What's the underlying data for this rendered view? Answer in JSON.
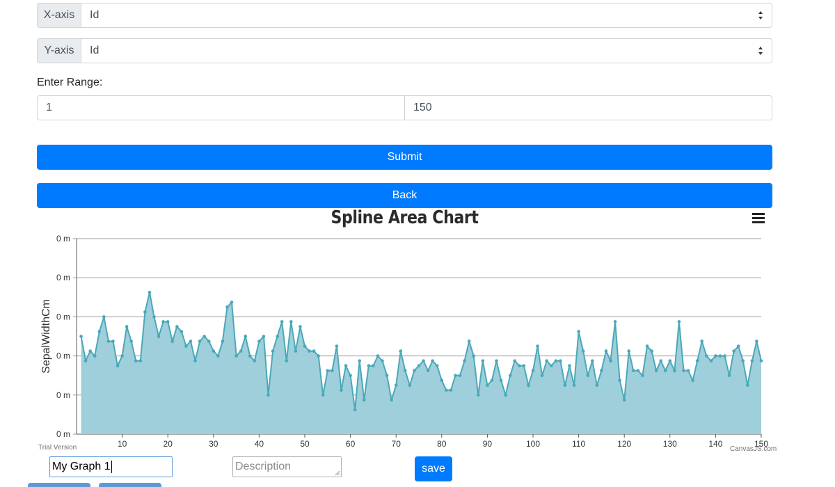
{
  "form": {
    "x_axis": {
      "label": "X-axis",
      "value": "Id"
    },
    "y_axis": {
      "label": "Y-axis",
      "value": "Id"
    },
    "range_label": "Enter Range:",
    "range_from": "1",
    "range_to": "150",
    "submit_label": "Submit",
    "back_label": "Back"
  },
  "chart_data": {
    "type": "area",
    "title": "Spline Area Chart",
    "xlabel": "",
    "ylabel": "SepalWidthCm",
    "xlim": [
      0,
      150
    ],
    "xticks": [
      10,
      20,
      30,
      40,
      50,
      60,
      70,
      80,
      90,
      100,
      110,
      120,
      130,
      140,
      150
    ],
    "ytick_labels": [
      "0 m",
      "0 m",
      "0 m",
      "0 m",
      "0 m",
      "0 m"
    ],
    "ylim": [
      1.5,
      5.5
    ],
    "grid": true,
    "color": "#4aa8b8",
    "fill": "#9ecfda",
    "x": [
      1,
      2,
      3,
      4,
      5,
      6,
      7,
      8,
      9,
      10,
      11,
      12,
      13,
      14,
      15,
      16,
      17,
      18,
      19,
      20,
      21,
      22,
      23,
      24,
      25,
      26,
      27,
      28,
      29,
      30,
      31,
      32,
      33,
      34,
      35,
      36,
      37,
      38,
      39,
      40,
      41,
      42,
      43,
      44,
      45,
      46,
      47,
      48,
      49,
      50,
      51,
      52,
      53,
      54,
      55,
      56,
      57,
      58,
      59,
      60,
      61,
      62,
      63,
      64,
      65,
      66,
      67,
      68,
      69,
      70,
      71,
      72,
      73,
      74,
      75,
      76,
      77,
      78,
      79,
      80,
      81,
      82,
      83,
      84,
      85,
      86,
      87,
      88,
      89,
      90,
      91,
      92,
      93,
      94,
      95,
      96,
      97,
      98,
      99,
      100,
      101,
      102,
      103,
      104,
      105,
      106,
      107,
      108,
      109,
      110,
      111,
      112,
      113,
      114,
      115,
      116,
      117,
      118,
      119,
      120,
      121,
      122,
      123,
      124,
      125,
      126,
      127,
      128,
      129,
      130,
      131,
      132,
      133,
      134,
      135,
      136,
      137,
      138,
      139,
      140,
      141,
      142,
      143,
      144,
      145,
      146,
      147,
      148,
      149,
      150
    ],
    "values": [
      3.5,
      3.0,
      3.2,
      3.1,
      3.6,
      3.9,
      3.4,
      3.4,
      2.9,
      3.1,
      3.7,
      3.4,
      3.0,
      3.0,
      4.0,
      4.4,
      3.9,
      3.5,
      3.8,
      3.8,
      3.4,
      3.7,
      3.6,
      3.3,
      3.4,
      3.0,
      3.4,
      3.5,
      3.4,
      3.2,
      3.1,
      3.4,
      4.1,
      4.2,
      3.1,
      3.2,
      3.5,
      3.1,
      3.0,
      3.4,
      3.5,
      2.3,
      3.2,
      3.5,
      3.8,
      3.0,
      3.8,
      3.2,
      3.7,
      3.3,
      3.2,
      3.2,
      3.1,
      2.3,
      2.8,
      2.8,
      3.3,
      2.4,
      2.9,
      2.7,
      2.0,
      3.0,
      2.2,
      2.9,
      2.9,
      3.1,
      3.0,
      2.7,
      2.2,
      2.5,
      3.2,
      2.8,
      2.5,
      2.8,
      2.9,
      3.0,
      2.8,
      3.0,
      2.9,
      2.6,
      2.4,
      2.4,
      2.7,
      2.7,
      3.0,
      3.4,
      3.1,
      2.3,
      3.0,
      2.5,
      2.6,
      3.0,
      2.6,
      2.3,
      2.7,
      3.0,
      2.9,
      2.9,
      2.5,
      2.8,
      3.3,
      2.7,
      3.0,
      2.9,
      3.0,
      3.0,
      2.5,
      2.9,
      2.5,
      3.6,
      3.2,
      2.7,
      3.0,
      2.5,
      2.8,
      3.2,
      3.0,
      3.8,
      2.6,
      2.2,
      3.2,
      2.8,
      2.8,
      2.7,
      3.3,
      3.2,
      2.8,
      3.0,
      2.8,
      3.0,
      2.8,
      3.8,
      2.8,
      2.8,
      2.6,
      3.0,
      3.4,
      3.1,
      3.0,
      3.1,
      3.1,
      3.1,
      2.7,
      3.2,
      3.3,
      3.0,
      2.5,
      3.0,
      3.4,
      3.0
    ]
  },
  "chart_credits": {
    "trial": "Trial Version",
    "credit": "CanvasJS.com"
  },
  "save_form": {
    "name_value": "My Graph 1",
    "description_placeholder": "Description",
    "save_label": "save"
  }
}
